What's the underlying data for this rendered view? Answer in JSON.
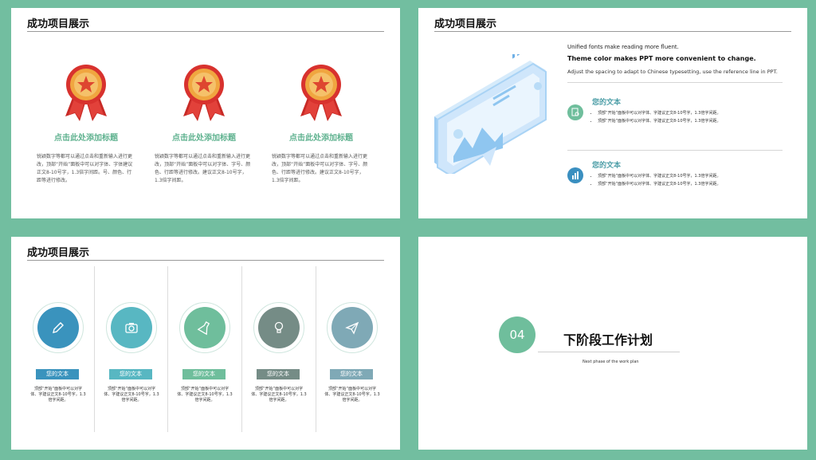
{
  "slides": [
    {
      "title": "成功项目展示",
      "columns": [
        {
          "heading": "点击此处添加标题",
          "body": "锐颖数字等都可以通过点击和重新输入进行更改，顶部“开始”面板中可以对字体、字体建议正文8-10号字，1.3倍字间距。号、颜色、行距等进行修改。"
        },
        {
          "heading": "点击此处添加标题",
          "body": "锐颖数字等都可以通过点击和重新输入进行更改，顶部“开始”面板中可以对字体、字号、颜色、行距等进行修改。建议正文8-10号字，1.3倍字间距。"
        },
        {
          "heading": "点击此处添加标题",
          "body": "锐颖数字等都可以通过点击和重新输入进行更改，顶部“开始”面板中可以对字体、字号、颜色、行距等进行修改。建议正文8-10号字，1.3倍字间距。"
        }
      ]
    },
    {
      "title": "成功项目展示",
      "line1": "Unified fonts make reading more fluent.",
      "line2": "Theme color makes PPT more convenient to change.",
      "line3": "Adjust the spacing to adapt to Chinese typesetting, use the reference line in PPT.",
      "items": [
        {
          "heading": "您的文本",
          "bullets": [
            "顶部“开始”面板中可以对字体、字建议正文8-10号字，1.3倍字间距。",
            "顶部“开始”面板中可以对字体、字建议正文8-10号字，1.3倍字间距。"
          ],
          "icon": "document-search-icon",
          "color": "#6fbe9c"
        },
        {
          "heading": "您的文本",
          "bullets": [
            "顶部“开始”面板中可以对字体、字建议正文8-10号字，1.3倍字间距。",
            "顶部“开始”面板中可以对字体、字建议正文8-10号字，1.3倍字间距。"
          ],
          "icon": "bar-chart-icon",
          "color": "#3a8fc0"
        }
      ]
    },
    {
      "title": "成功项目展示",
      "columns": [
        {
          "label": "您的文本",
          "body": "顶部“开始”面板中可以对字体、字建议正文8-10号字，1.3倍字间距。",
          "icon": "pencil-icon",
          "color": "#3a93bd"
        },
        {
          "label": "您的文本",
          "body": "顶部“开始”面板中可以对字体、字建议正文8-10号字，1.3倍字间距。",
          "icon": "camera-icon",
          "color": "#58b7c2"
        },
        {
          "label": "您的文本",
          "body": "顶部“开始”面板中可以对字体、字建议正文8-10号字，1.3倍字间距。",
          "icon": "flask-icon",
          "color": "#6fbe9c"
        },
        {
          "label": "您的文本",
          "body": "顶部“开始”面板中可以对字体、字建议正文8-10号字，1.3倍字间距。",
          "icon": "lightbulb-icon",
          "color": "#758c86"
        },
        {
          "label": "您的文本",
          "body": "顶部“开始”面板中可以对字体、字建议正文8-10号字，1.3倍字间距。",
          "icon": "paper-plane-icon",
          "color": "#7fa9b6"
        }
      ]
    },
    {
      "number": "04",
      "title": "下阶段工作计划",
      "subtitle": "Next phase of the work plan"
    }
  ],
  "colors": {
    "background": "#72bea0",
    "accent_green": "#6fbe9c",
    "accent_blue": "#3a8fc0",
    "medal_red": "#d8322e",
    "medal_gold": "#f0a640"
  }
}
